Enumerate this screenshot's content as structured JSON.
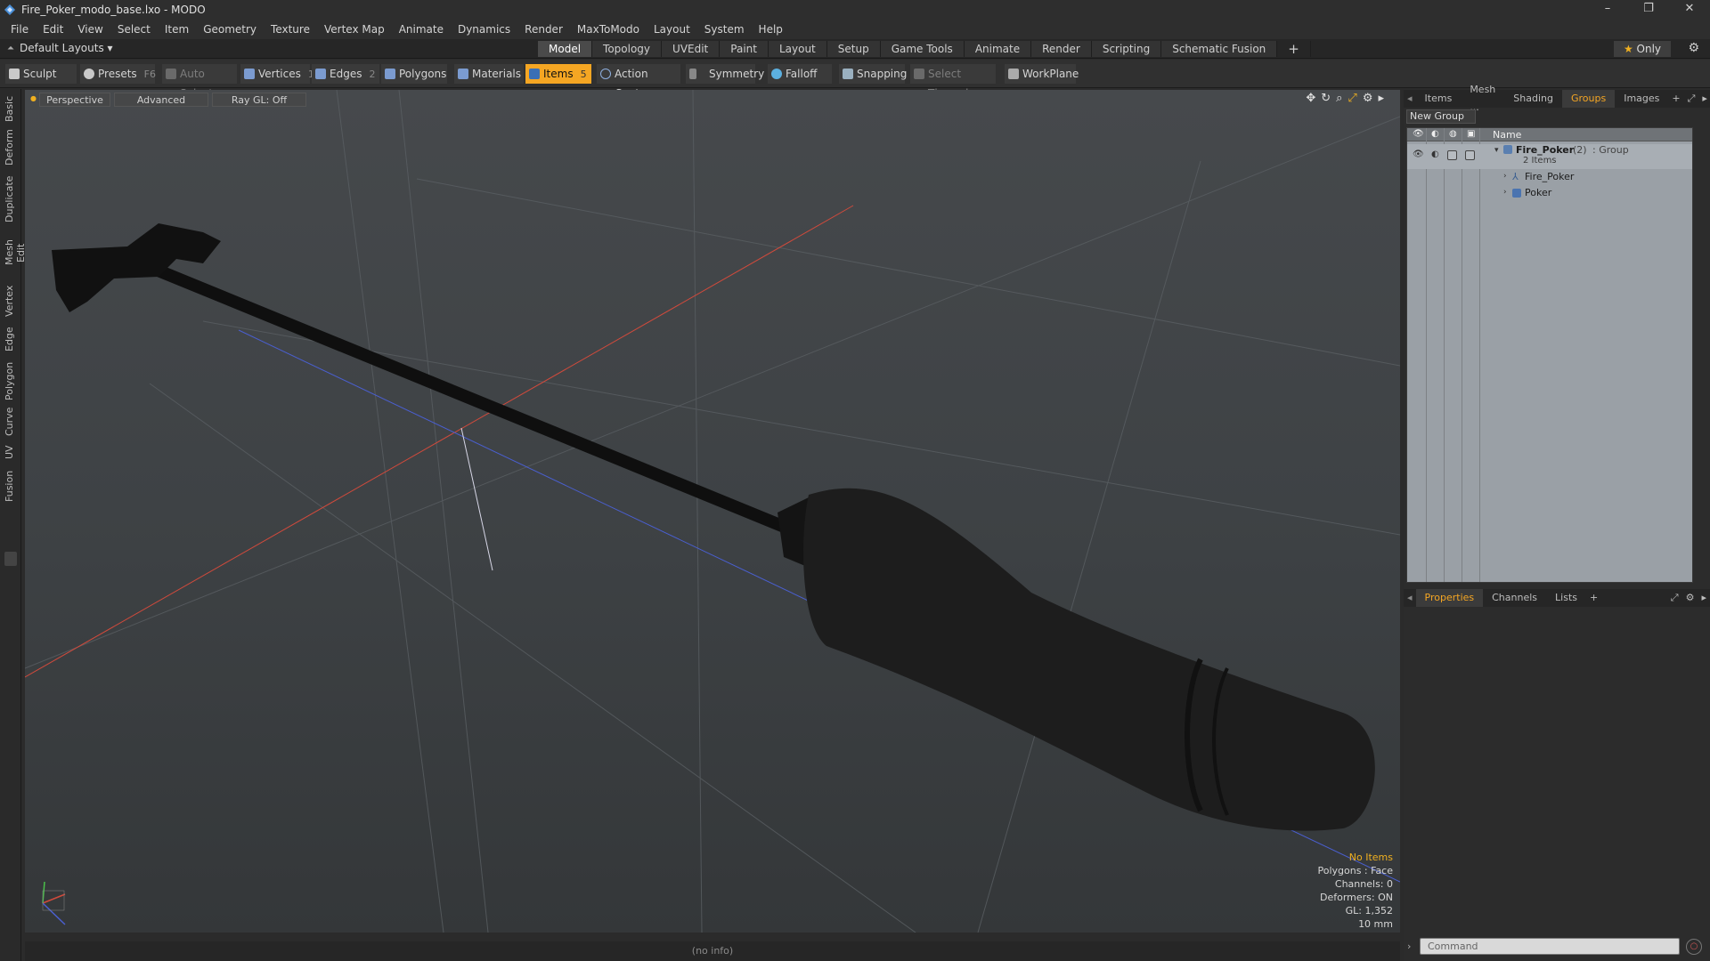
{
  "window": {
    "title": "Fire_Poker_modo_base.lxo - MODO",
    "controls": [
      "–",
      "❐",
      "✕"
    ]
  },
  "menu": [
    "File",
    "Edit",
    "View",
    "Select",
    "Item",
    "Geometry",
    "Texture",
    "Vertex Map",
    "Animate",
    "Dynamics",
    "Render",
    "MaxToModo",
    "Layout",
    "System",
    "Help"
  ],
  "layout_bar": {
    "layouts_label": "Default Layouts ▾",
    "tabs": [
      "Model",
      "Topology",
      "UVEdit",
      "Paint",
      "Layout",
      "Setup",
      "Game Tools",
      "Animate",
      "Render",
      "Scripting",
      "Schematic Fusion"
    ],
    "active_tab": "Model",
    "add_label": "+",
    "only_label": "Only"
  },
  "toolbar": {
    "sculpt": "Sculpt",
    "presets": "Presets",
    "presets_key": "F6",
    "auto_select": "Auto Select",
    "vertices": "Vertices",
    "vertices_key": "1",
    "edges": "Edges",
    "edges_key": "2",
    "polygons": "Polygons",
    "materials": "Materials",
    "items": "Items",
    "items_key": "5",
    "action_center": "Action Center",
    "symmetry": "Symmetry",
    "falloff": "Falloff",
    "snapping": "Snapping",
    "select_through": "Select Through",
    "workplane": "WorkPlane"
  },
  "left_tabs": [
    "Basic",
    "Deform",
    "Duplicate",
    "Mesh Edit",
    "Vertex",
    "Edge",
    "Polygon",
    "Curve",
    "UV",
    "Fusion"
  ],
  "viewport": {
    "view_mode": "Perspective",
    "shading": "Advanced",
    "raygl": "Ray GL: Off",
    "info": {
      "selection": "No Items",
      "polygons": "Polygons : Face",
      "channels": "Channels: 0",
      "deformers": "Deformers: ON",
      "gl": "GL: 1,352",
      "grid": "10 mm"
    },
    "status": "(no info)"
  },
  "right_panel": {
    "top_tabs": [
      "Items",
      "Mesh ...",
      "Shading",
      "Groups",
      "Images"
    ],
    "active_top_tab": "Groups",
    "new_group": "New Group",
    "column_name": "Name",
    "tree": {
      "group_name": "Fire_Poker",
      "group_count": "(2)",
      "group_type": ": Group",
      "group_sub": "2 Items",
      "children": [
        "Fire_Poker",
        "Poker"
      ]
    },
    "bottom_tabs": [
      "Properties",
      "Channels",
      "Lists"
    ],
    "active_bottom_tab": "Properties",
    "command_placeholder": "Command"
  },
  "colors": {
    "accent": "#f5a623",
    "x_axis": "#d04a3c",
    "z_axis": "#4a5fd0",
    "y_axis": "#4ac04a"
  }
}
